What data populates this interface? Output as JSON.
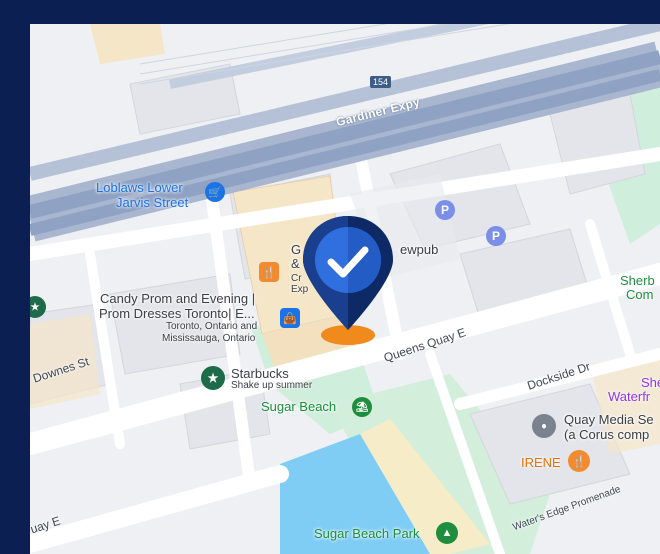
{
  "map": {
    "roads": {
      "gardiner": "Gardiner Expy",
      "route_shield": "154",
      "queens_quay": "Queens Quay E",
      "dockside": "Dockside Dr",
      "downes": "Downes St",
      "queens_quay_left": "uay E",
      "waters_edge": "Water's Edge Promenade"
    },
    "places": {
      "loblaws_line1": "Loblaws Lower",
      "loblaws_line2": "Jarvis Street",
      "candy_line1": "Candy Prom and Evening |",
      "candy_line2": "Prom Dresses Toronto| E...",
      "candy_sub1": "Toronto, Ontario and",
      "candy_sub2": "Mississauga, Ontario",
      "g_partial": "G",
      "amp_partial": "&",
      "cr_partial": "Cr",
      "exp_partial": "Exp",
      "brewpub_partial": "ewpub",
      "starbucks": "Starbucks",
      "starbucks_sub": "Shake up summer",
      "sugar_beach": "Sugar Beach",
      "quay_media_line1": "Quay Media Se",
      "quay_media_line2": "(a Corus comp",
      "irene": "IRENE",
      "sugar_beach_park": "Sugar Beach Park",
      "sherb_line1": "Sherb",
      "sherb_line2": "Com",
      "she_line1": "She",
      "she_line2": "Waterfr"
    },
    "icons": {
      "parking": "P",
      "marker": "selected-location-pin"
    },
    "colors": {
      "frame": "#0b1f52",
      "pin_dark": "#0d2a66",
      "pin_blue": "#2f6fde",
      "pin_shadow": "#f08a1c",
      "water": "#7fcdf5",
      "park": "#c8ecd2",
      "expressway": "#8fa2c4"
    }
  }
}
